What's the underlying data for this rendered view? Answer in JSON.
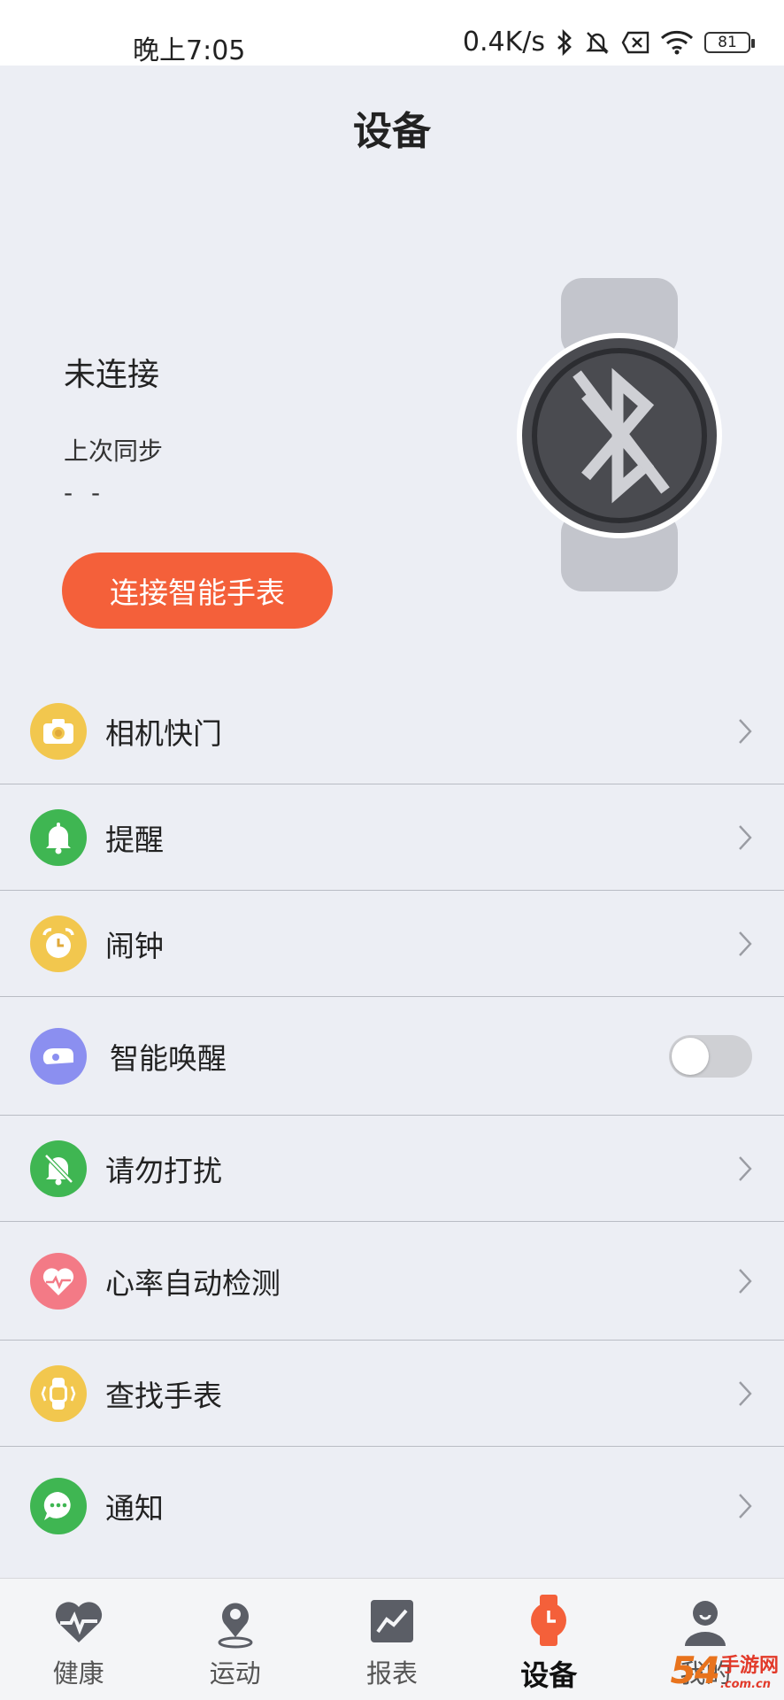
{
  "status_bar": {
    "time": "晚上7:05",
    "net_speed": "0.4K/s",
    "battery": "81"
  },
  "header": {
    "title": "设备"
  },
  "device": {
    "connection_status": "未连接",
    "sync_label": "上次同步",
    "sync_value": "- -",
    "connect_button": "连接智能手表",
    "watch_icon": "watch-bluetooth-disconnected-icon"
  },
  "settings": {
    "items": [
      {
        "label": "相机快门",
        "icon": "camera-icon",
        "icon_color": "#f2c74e",
        "control": "chevron"
      },
      {
        "label": "提醒",
        "icon": "bell-icon",
        "icon_color": "#3fb652",
        "control": "chevron"
      },
      {
        "label": "闹钟",
        "icon": "alarm-clock-icon",
        "icon_color": "#f2c74e",
        "control": "chevron"
      },
      {
        "label": "智能唤醒",
        "icon": "wrist-band-icon",
        "icon_color": "#8b8ff0",
        "control": "toggle",
        "toggle_on": false
      },
      {
        "label": "请勿打扰",
        "icon": "bell-off-icon",
        "icon_color": "#3fb652",
        "control": "chevron"
      },
      {
        "label": "心率自动检测",
        "icon": "heart-rate-icon",
        "icon_color": "#f37a86",
        "control": "chevron"
      },
      {
        "label": "查找手表",
        "icon": "find-watch-icon",
        "icon_color": "#f2c74e",
        "control": "chevron"
      },
      {
        "label": "通知",
        "icon": "message-icon",
        "icon_color": "#3fb652",
        "control": "chevron"
      }
    ]
  },
  "bottom_nav": {
    "items": [
      {
        "label": "健康",
        "icon": "heart-pulse-icon"
      },
      {
        "label": "运动",
        "icon": "location-pin-icon"
      },
      {
        "label": "报表",
        "icon": "chart-icon"
      },
      {
        "label": "设备",
        "icon": "watch-icon",
        "active": true
      },
      {
        "label": "我的",
        "icon": "user-icon"
      }
    ]
  },
  "watermark": {
    "number": "54",
    "brand": "手游网",
    "domain": ".com.cn"
  },
  "colors": {
    "accent": "#f4603a",
    "background": "#eceef4",
    "divider": "#b9bcc4"
  }
}
